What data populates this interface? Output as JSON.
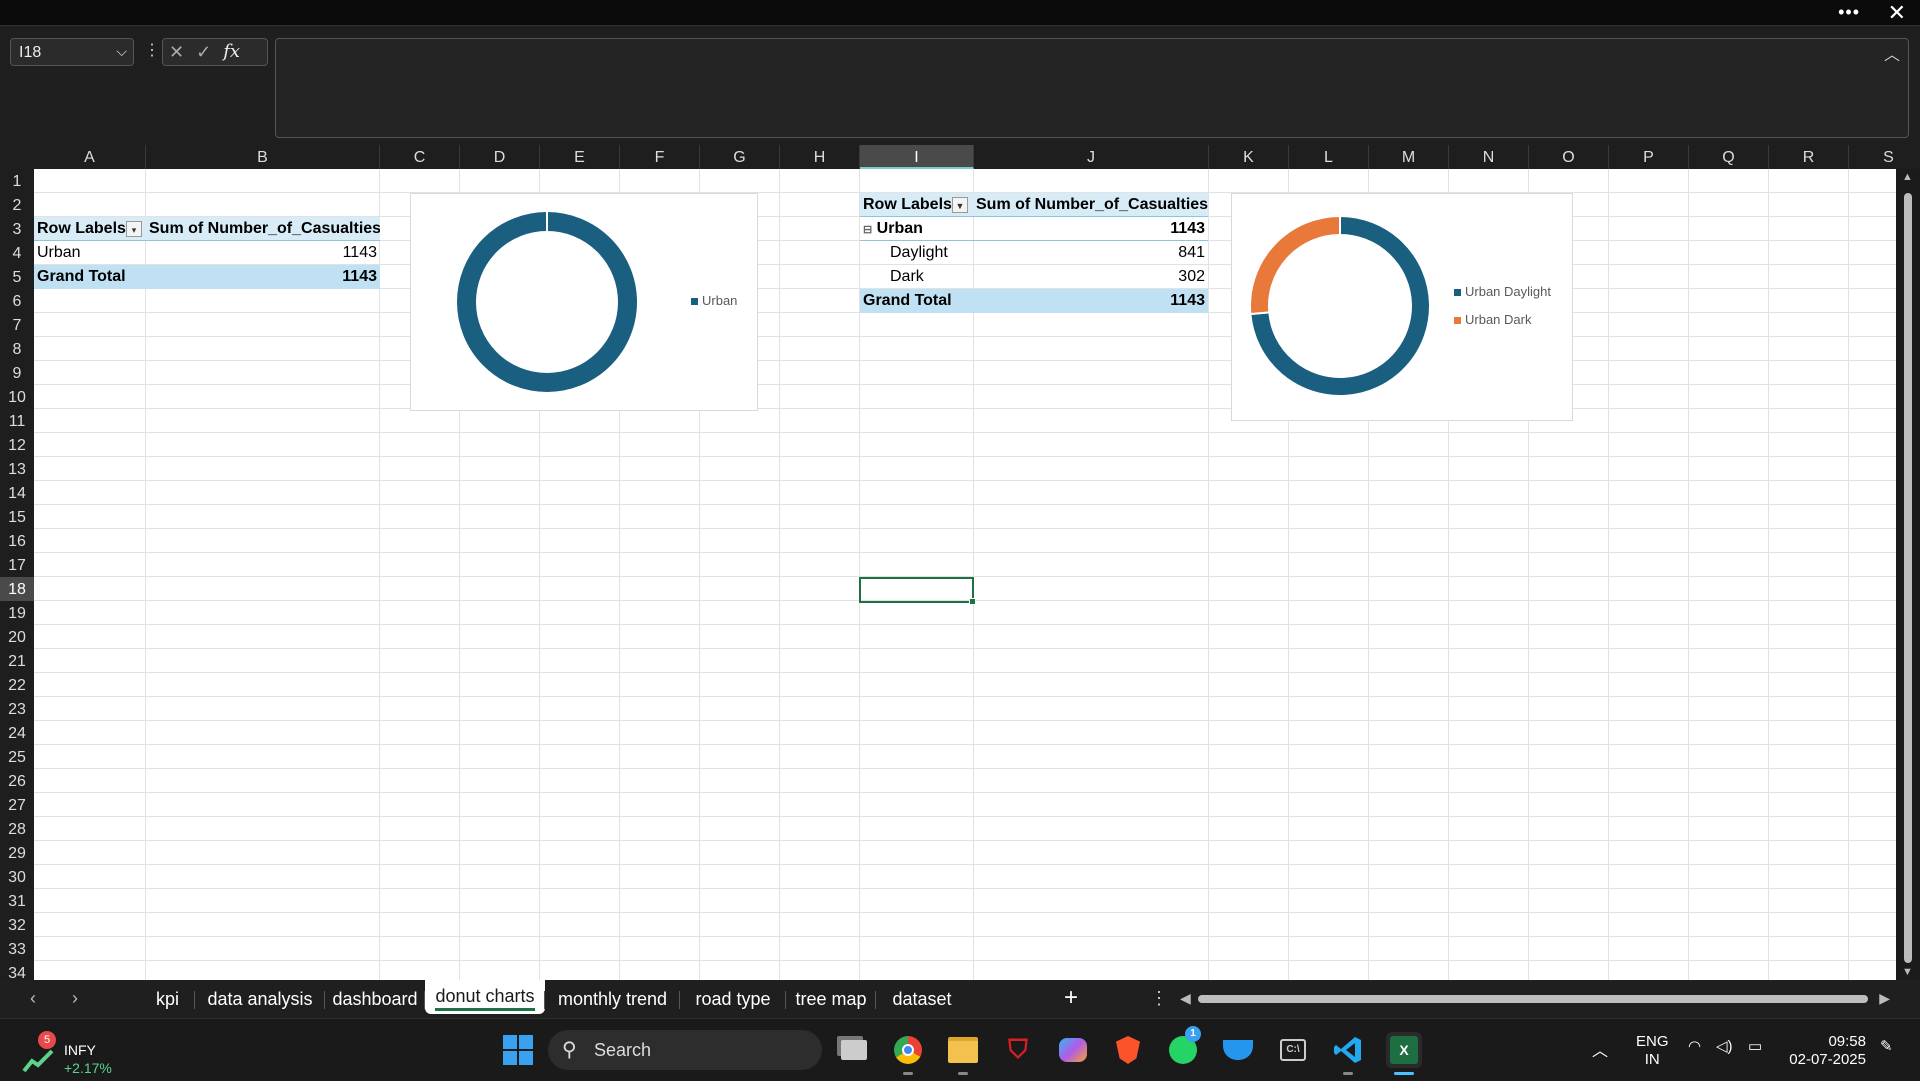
{
  "window": {
    "more": "•••",
    "close": "✕"
  },
  "formula_bar": {
    "name_box": "I18",
    "cancel": "✕",
    "enter": "✓",
    "fx": "fx",
    "formula": ""
  },
  "columns": [
    "A",
    "B",
    "C",
    "D",
    "E",
    "F",
    "G",
    "H",
    "I",
    "J",
    "K",
    "L",
    "M",
    "N",
    "O",
    "P",
    "Q",
    "R",
    "S"
  ],
  "selected_column": "I",
  "rows": [
    "1",
    "2",
    "3",
    "4",
    "5",
    "6",
    "7",
    "8",
    "9",
    "10",
    "11",
    "12",
    "13",
    "14",
    "15",
    "16",
    "17",
    "18",
    "19",
    "20",
    "21",
    "22",
    "23",
    "24",
    "25",
    "26",
    "27",
    "28",
    "29",
    "30",
    "31",
    "32",
    "33",
    "34"
  ],
  "selected_row": "18",
  "pivot1": {
    "row_labels": "Row Labels",
    "value_header": "Sum of Number_of_Casualties",
    "rows": [
      {
        "label": "Urban",
        "value": "1143"
      }
    ],
    "grand_total_label": "Grand Total",
    "grand_total": "1143"
  },
  "pivot2": {
    "row_labels": "Row Labels",
    "value_header": "Sum of Number_of_Casualties",
    "group": {
      "label": "Urban",
      "value": "1143",
      "toggle": "⊟"
    },
    "rows": [
      {
        "label": "Daylight",
        "value": "841"
      },
      {
        "label": "Dark",
        "value": "302"
      }
    ],
    "grand_total_label": "Grand Total",
    "grand_total": "1143"
  },
  "chart_data": [
    {
      "type": "pie",
      "style": "donut",
      "title": "",
      "categories": [
        "Urban"
      ],
      "values": [
        1143
      ],
      "colors": [
        "#1b5f80"
      ],
      "legend": [
        "Urban"
      ],
      "legend_position": "right"
    },
    {
      "type": "pie",
      "style": "donut",
      "title": "",
      "categories": [
        "Urban Daylight",
        "Urban Dark"
      ],
      "values": [
        841,
        302
      ],
      "colors": [
        "#1b5f80",
        "#e8793a"
      ],
      "legend": [
        "Urban Daylight",
        "Urban Dark"
      ],
      "legend_position": "right"
    }
  ],
  "sheet_tabs": [
    "kpi",
    "data analysis",
    "dashboard",
    "donut charts",
    "monthly trend",
    "road type",
    "tree map",
    "dataset"
  ],
  "active_tab": "donut charts",
  "taskbar": {
    "stock_name": "INFY",
    "stock_change": "+2.17%",
    "stock_badge": "5",
    "search": "Search",
    "whatsapp_badge": "1",
    "lang": "ENG",
    "region": "IN",
    "time": "09:58",
    "date": "02-07-2025"
  }
}
